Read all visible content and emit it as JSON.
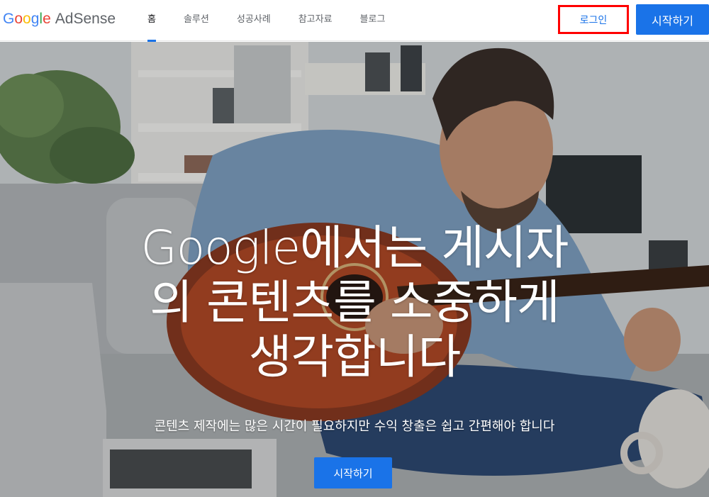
{
  "header": {
    "logo": {
      "google_letters": [
        "G",
        "o",
        "o",
        "g",
        "l",
        "e"
      ],
      "product": "AdSense"
    },
    "nav": [
      {
        "label": "홈",
        "active": true
      },
      {
        "label": "솔루션",
        "active": false
      },
      {
        "label": "성공사례",
        "active": false
      },
      {
        "label": "참고자료",
        "active": false
      },
      {
        "label": "블로그",
        "active": false
      }
    ],
    "login_label": "로그인",
    "start_label": "시작하기"
  },
  "hero": {
    "headline_lines": [
      "Google에서는 게시자",
      "의 콘텐츠를 소중하게",
      "생각합니다"
    ],
    "subtext": "콘텐츠 제작에는 많은 시간이 필요하지만 수익 창출은 쉽고 간편해야 합니다",
    "cta_label": "시작하기"
  },
  "colors": {
    "primary": "#1a73e8",
    "highlight_border": "#ff0000",
    "google_blue": "#4285F4",
    "google_red": "#EA4335",
    "google_yellow": "#FBBC05",
    "google_green": "#34A853"
  }
}
